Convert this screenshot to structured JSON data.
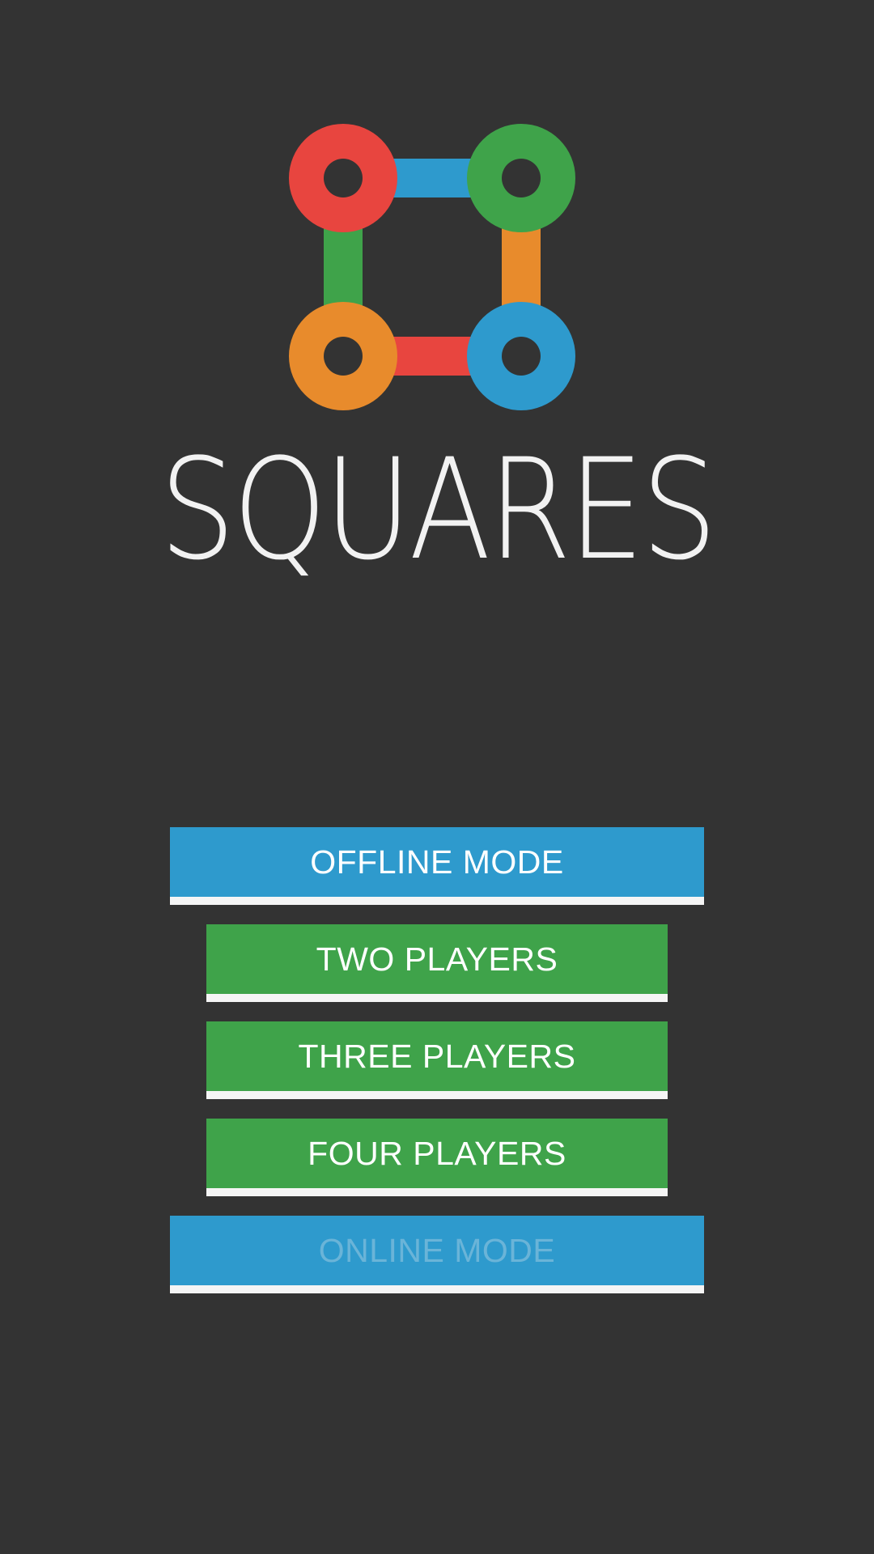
{
  "app": {
    "title": "SQUARES"
  },
  "colors": {
    "background": "#333333",
    "red": "#E8453F",
    "green": "#3FA34A",
    "orange": "#E88B2C",
    "blue": "#2E9ACD",
    "button_underline": "#F5F5F5",
    "disabled_text": "#6AB4D8"
  },
  "logo": {
    "nodes": [
      {
        "name": "top-left",
        "color": "red"
      },
      {
        "name": "top-right",
        "color": "green"
      },
      {
        "name": "bottom-left",
        "color": "orange"
      },
      {
        "name": "bottom-right",
        "color": "blue"
      }
    ],
    "edges": [
      {
        "name": "top",
        "color": "blue"
      },
      {
        "name": "left",
        "color": "green"
      },
      {
        "name": "right",
        "color": "orange"
      },
      {
        "name": "bottom",
        "color": "red"
      }
    ]
  },
  "menu": {
    "offline_mode": {
      "label": "OFFLINE MODE",
      "color": "blue",
      "enabled": true
    },
    "two_players": {
      "label": "TWO PLAYERS",
      "color": "green",
      "enabled": true
    },
    "three_players": {
      "label": "THREE PLAYERS",
      "color": "green",
      "enabled": true
    },
    "four_players": {
      "label": "FOUR PLAYERS",
      "color": "green",
      "enabled": true
    },
    "online_mode": {
      "label": "ONLINE MODE",
      "color": "blue",
      "enabled": false
    }
  }
}
